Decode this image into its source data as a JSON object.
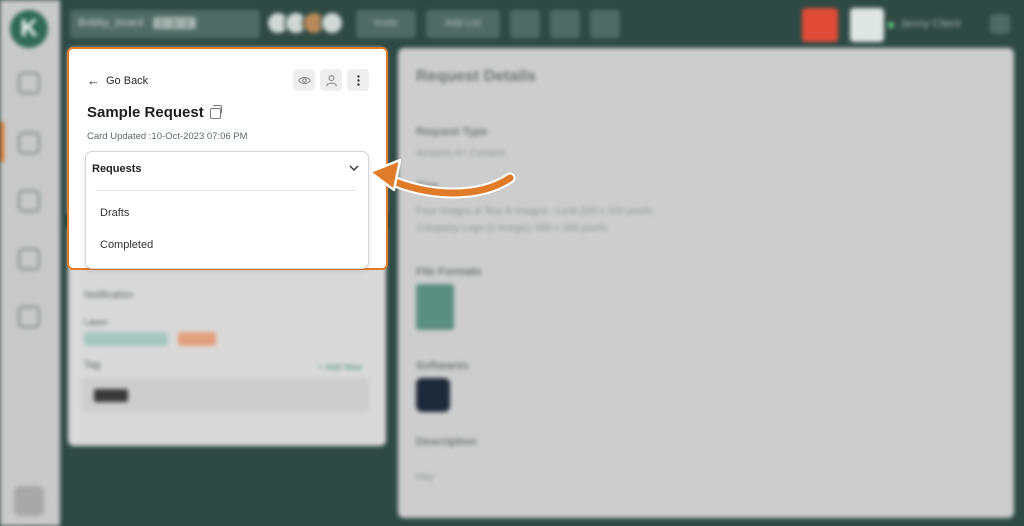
{
  "topbar": {
    "workspace_label": "Bobby_board",
    "workspace_tag": "1 - 3 - 2",
    "button_1": "Invite",
    "button_2": "Add List",
    "user_name": "Jenny Client"
  },
  "right_panel": {
    "title": "Request Details",
    "request_type_label": "Request Type",
    "request_type_value": "Amazon A+ Content",
    "size_label": "Size",
    "size_line_1": "Four Images & Text & Images - Limit 220 x 220 pixels",
    "size_line_2": "Company Logo (1 Image): 600 x 180 pixels",
    "file_formats_label": "File Formats",
    "software_label": "Softwares",
    "description_label": "Description",
    "description_value": "Hey"
  },
  "left_panel": {
    "notification_label": "Notification",
    "labels_label": "Labels",
    "tag_label": "Tag",
    "add_new": "+ Add New"
  },
  "popup": {
    "go_back": "Go Back",
    "title": "Sample Request",
    "updated": "Card Updated :10-Oct-2023 07:06 PM",
    "icons": [
      "eye-icon",
      "user-icon",
      "more-vertical-icon"
    ]
  },
  "dropdown": {
    "selected": "Requests",
    "options": [
      "Drafts",
      "Completed"
    ]
  },
  "colors": {
    "accent_orange": "#e07b2a",
    "brand_green": "#2f4a44"
  }
}
